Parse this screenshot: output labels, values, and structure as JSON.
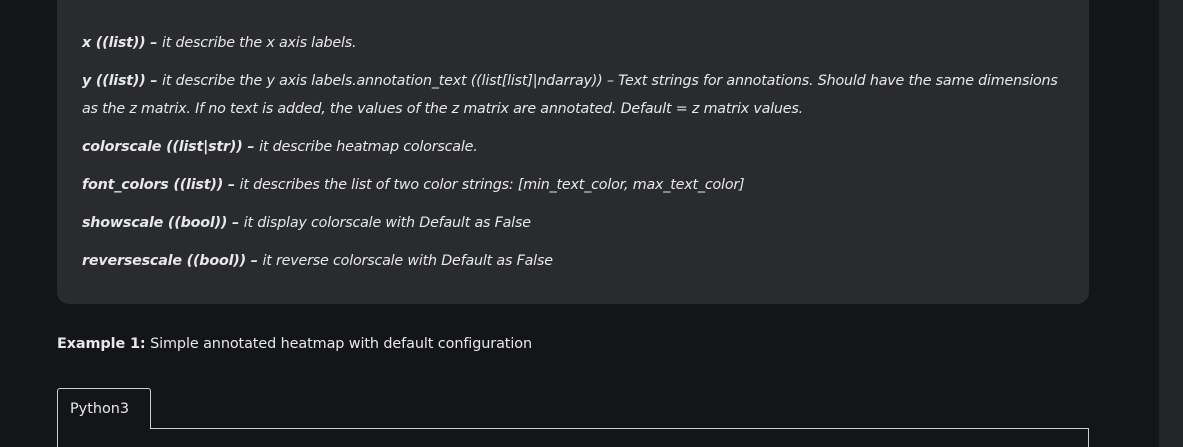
{
  "params": [
    {
      "name": "x ((list))",
      "sep": " – ",
      "desc": "it describe the x axis labels."
    },
    {
      "name": "y ((list))",
      "sep": " – ",
      "desc": "it describe the y axis labels.annotation_text ((list[list]|ndarray)) – Text strings for annotations. Should have the same dimensions as the z matrix. If no text is added, the values of the z matrix are annotated. Default = z matrix values."
    },
    {
      "name": "colorscale ((list|str))",
      "sep": " – ",
      "desc": "it describe heatmap colorscale."
    },
    {
      "name": "font_colors ((list))",
      "sep": " – ",
      "desc": "it describes the list of two color strings: [min_text_color, max_text_color]"
    },
    {
      "name": "showscale ((bool))",
      "sep": " – ",
      "desc": "it display colorscale with Default as False"
    },
    {
      "name": "reversescale ((bool))",
      "sep": " – ",
      "desc": "it reverse colorscale with Default as False"
    }
  ],
  "example": {
    "label": "Example 1:",
    "text": " Simple annotated heatmap with default configuration"
  },
  "code_tab": {
    "label": "Python3"
  }
}
